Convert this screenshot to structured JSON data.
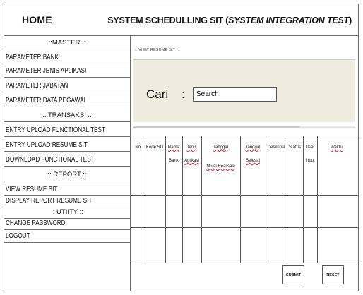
{
  "header": {
    "home": "HOME",
    "title_main": "SYSTEM SCHEDULLING SIT (",
    "title_italic": "SYSTEM INTEGRATION TEST",
    "title_end": ")"
  },
  "sidebar": {
    "master_section": "::MASTER ::",
    "master_items": [
      "PARAMETER BANK",
      "PARAMETER JENIS APLIKASI",
      "PARAMETER JABATAN",
      "PARAMETER DATA PEGAWAI"
    ],
    "transaksi_section": ":: TRANSAKSI ::",
    "transaksi_items": [
      "ENTRY UPLOAD FUNCTIONAL TEST",
      "ENTRY UPLOAD RESUME SIT",
      "DOWNLOAD FUNCTIONAL TEST"
    ],
    "report_section": ":: REPORT ::",
    "report_items": [
      "VIEW RESUME SIT",
      "DISPLAY REPORT RESUME SIT"
    ],
    "utility_section": ":: UTIITY ::",
    "utility_items": [
      "CHANGE PASSWORD",
      "LOGOUT"
    ]
  },
  "main": {
    "section_label": ":: VIEW RESUME SIT ::",
    "search_label": "Cari",
    "search_colon": ":",
    "search_value": "Search"
  },
  "table": {
    "h_no": "No.",
    "h_kode": "Kode SIT",
    "h_nama1": "Nama",
    "h_nama2": "Bank",
    "h_jenis1": "Jenis",
    "h_jenis2": "Aplikasi",
    "h_tgl1": "Tanggal",
    "h_tgl2": "Mulai Realisasi",
    "h_tgls1": "Tanggal",
    "h_tgls2": "Selesai",
    "h_deskripsi": "Deskripsi",
    "h_status": "Status",
    "h_user1": "User",
    "h_user2": "Input",
    "h_waktu": "Waktu"
  },
  "buttons": {
    "submit": "SUBMIT",
    "reset": "RESET"
  }
}
